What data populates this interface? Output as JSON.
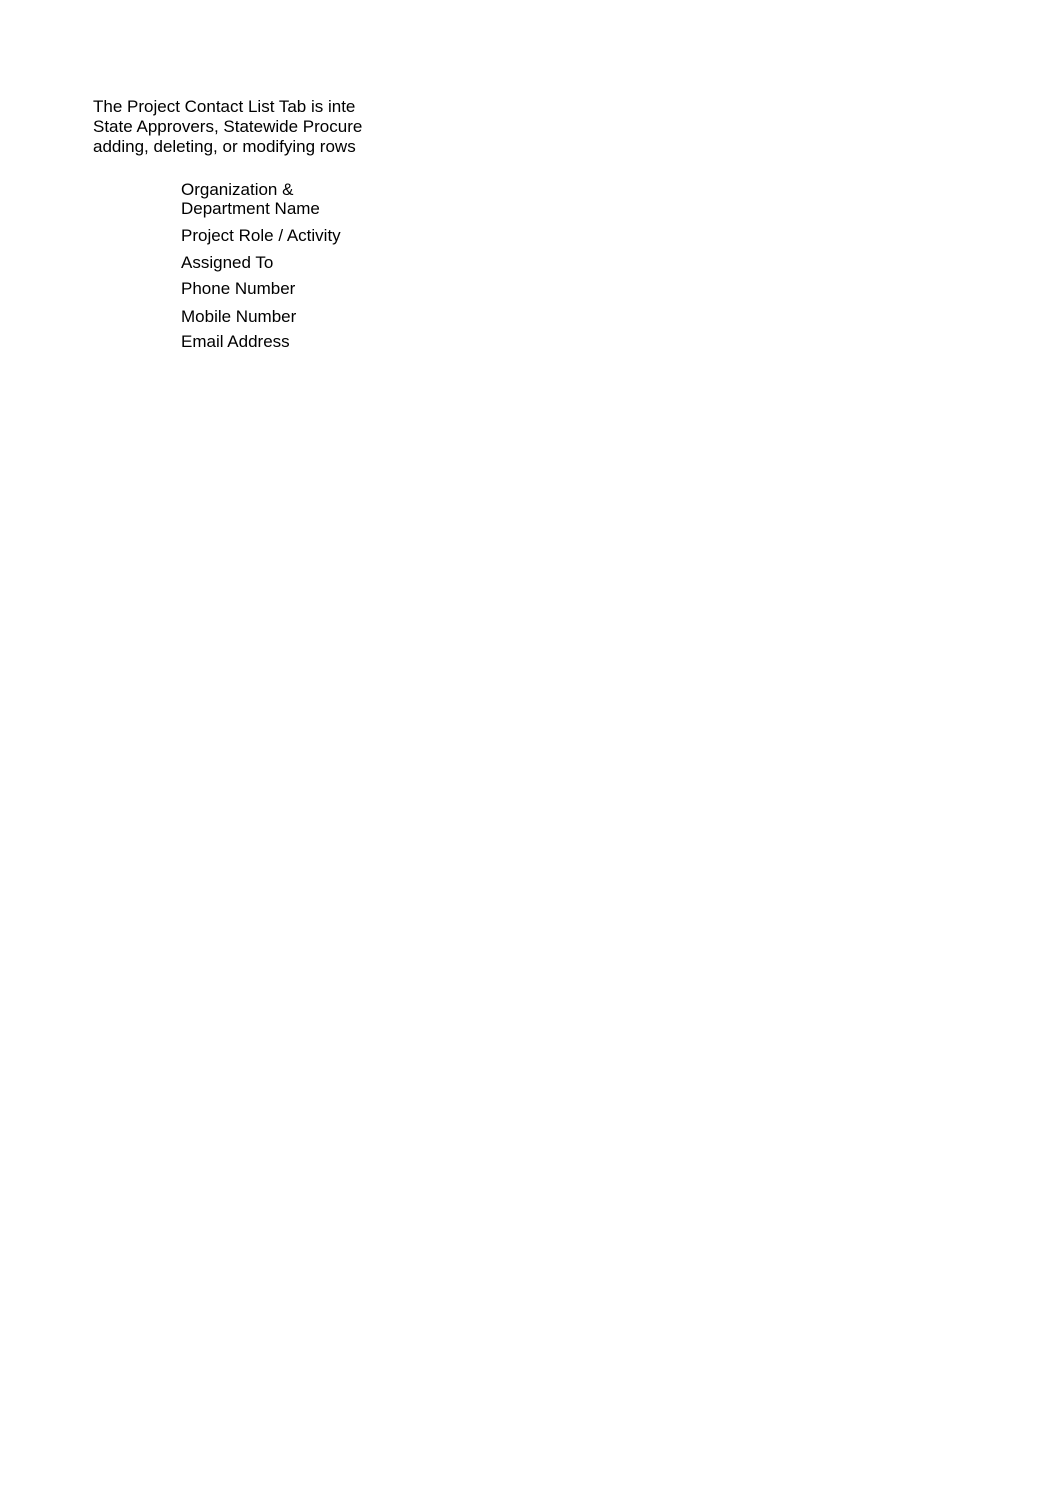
{
  "document": {
    "intro_lines": [
      "The Project Contact List Tab is inte",
      "State Approvers, Statewide Procure",
      "adding, deleting, or modifying rows"
    ],
    "field_labels": [
      {
        "lines": [
          "Organization &",
          "Department Name"
        ]
      },
      {
        "lines": [
          "Project Role / Activity"
        ]
      },
      {
        "lines": [
          "Assigned To"
        ]
      },
      {
        "lines": [
          "Phone Number"
        ]
      },
      {
        "lines": [
          "Mobile Number"
        ]
      },
      {
        "lines": [
          "Email Address"
        ]
      }
    ]
  }
}
